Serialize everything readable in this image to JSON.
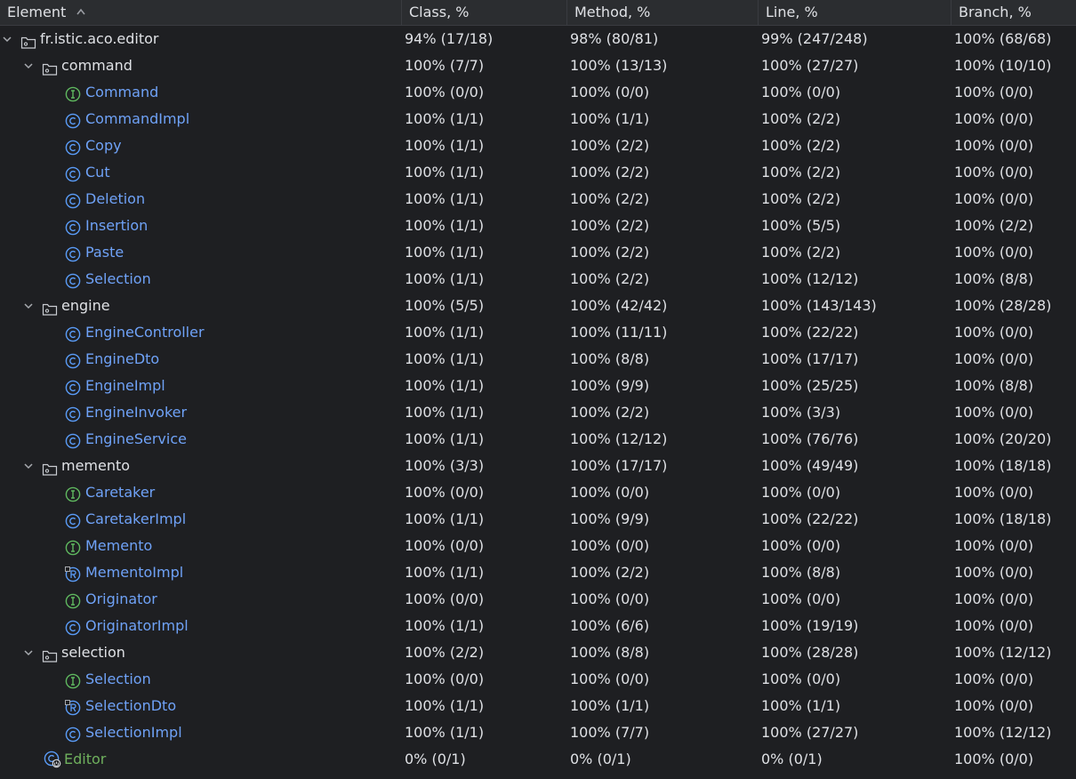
{
  "header": {
    "element": "Element",
    "class_pct": "Class, %",
    "method_pct": "Method, %",
    "line_pct": "Line, %",
    "branch_pct": "Branch, %"
  },
  "rows": [
    {
      "name": "fr.istic.aco.editor",
      "kind": "package",
      "level": 0,
      "expanded": true,
      "class": "94% (17/18)",
      "method": "98% (80/81)",
      "line": "99% (247/248)",
      "branch": "100% (68/68)"
    },
    {
      "name": "command",
      "kind": "package",
      "level": 1,
      "expanded": true,
      "class": "100% (7/7)",
      "method": "100% (13/13)",
      "line": "100% (27/27)",
      "branch": "100% (10/10)"
    },
    {
      "name": "Command",
      "kind": "interface",
      "level": 2,
      "class": "100% (0/0)",
      "method": "100% (0/0)",
      "line": "100% (0/0)",
      "branch": "100% (0/0)"
    },
    {
      "name": "CommandImpl",
      "kind": "class",
      "level": 2,
      "class": "100% (1/1)",
      "method": "100% (1/1)",
      "line": "100% (2/2)",
      "branch": "100% (0/0)"
    },
    {
      "name": "Copy",
      "kind": "class",
      "level": 2,
      "class": "100% (1/1)",
      "method": "100% (2/2)",
      "line": "100% (2/2)",
      "branch": "100% (0/0)"
    },
    {
      "name": "Cut",
      "kind": "class",
      "level": 2,
      "class": "100% (1/1)",
      "method": "100% (2/2)",
      "line": "100% (2/2)",
      "branch": "100% (0/0)"
    },
    {
      "name": "Deletion",
      "kind": "class",
      "level": 2,
      "class": "100% (1/1)",
      "method": "100% (2/2)",
      "line": "100% (2/2)",
      "branch": "100% (0/0)"
    },
    {
      "name": "Insertion",
      "kind": "class",
      "level": 2,
      "class": "100% (1/1)",
      "method": "100% (2/2)",
      "line": "100% (5/5)",
      "branch": "100% (2/2)"
    },
    {
      "name": "Paste",
      "kind": "class",
      "level": 2,
      "class": "100% (1/1)",
      "method": "100% (2/2)",
      "line": "100% (2/2)",
      "branch": "100% (0/0)"
    },
    {
      "name": "Selection",
      "kind": "class",
      "level": 2,
      "class": "100% (1/1)",
      "method": "100% (2/2)",
      "line": "100% (12/12)",
      "branch": "100% (8/8)"
    },
    {
      "name": "engine",
      "kind": "package",
      "level": 1,
      "expanded": true,
      "class": "100% (5/5)",
      "method": "100% (42/42)",
      "line": "100% (143/143)",
      "branch": "100% (28/28)"
    },
    {
      "name": "EngineController",
      "kind": "class",
      "level": 2,
      "class": "100% (1/1)",
      "method": "100% (11/11)",
      "line": "100% (22/22)",
      "branch": "100% (0/0)"
    },
    {
      "name": "EngineDto",
      "kind": "class",
      "level": 2,
      "class": "100% (1/1)",
      "method": "100% (8/8)",
      "line": "100% (17/17)",
      "branch": "100% (0/0)"
    },
    {
      "name": "EngineImpl",
      "kind": "class",
      "level": 2,
      "class": "100% (1/1)",
      "method": "100% (9/9)",
      "line": "100% (25/25)",
      "branch": "100% (8/8)"
    },
    {
      "name": "EngineInvoker",
      "kind": "class",
      "level": 2,
      "class": "100% (1/1)",
      "method": "100% (2/2)",
      "line": "100% (3/3)",
      "branch": "100% (0/0)"
    },
    {
      "name": "EngineService",
      "kind": "class",
      "level": 2,
      "class": "100% (1/1)",
      "method": "100% (12/12)",
      "line": "100% (76/76)",
      "branch": "100% (20/20)"
    },
    {
      "name": "memento",
      "kind": "package",
      "level": 1,
      "expanded": true,
      "class": "100% (3/3)",
      "method": "100% (17/17)",
      "line": "100% (49/49)",
      "branch": "100% (18/18)"
    },
    {
      "name": "Caretaker",
      "kind": "interface",
      "level": 2,
      "class": "100% (0/0)",
      "method": "100% (0/0)",
      "line": "100% (0/0)",
      "branch": "100% (0/0)"
    },
    {
      "name": "CaretakerImpl",
      "kind": "class",
      "level": 2,
      "class": "100% (1/1)",
      "method": "100% (9/9)",
      "line": "100% (22/22)",
      "branch": "100% (18/18)"
    },
    {
      "name": "Memento",
      "kind": "interface",
      "level": 2,
      "class": "100% (0/0)",
      "method": "100% (0/0)",
      "line": "100% (0/0)",
      "branch": "100% (0/0)"
    },
    {
      "name": "MementoImpl",
      "kind": "record",
      "level": 2,
      "class": "100% (1/1)",
      "method": "100% (2/2)",
      "line": "100% (8/8)",
      "branch": "100% (0/0)"
    },
    {
      "name": "Originator",
      "kind": "interface",
      "level": 2,
      "class": "100% (0/0)",
      "method": "100% (0/0)",
      "line": "100% (0/0)",
      "branch": "100% (0/0)"
    },
    {
      "name": "OriginatorImpl",
      "kind": "class",
      "level": 2,
      "class": "100% (1/1)",
      "method": "100% (6/6)",
      "line": "100% (19/19)",
      "branch": "100% (0/0)"
    },
    {
      "name": "selection",
      "kind": "package",
      "level": 1,
      "expanded": true,
      "class": "100% (2/2)",
      "method": "100% (8/8)",
      "line": "100% (28/28)",
      "branch": "100% (12/12)"
    },
    {
      "name": "Selection",
      "kind": "interface",
      "level": 2,
      "class": "100% (0/0)",
      "method": "100% (0/0)",
      "line": "100% (0/0)",
      "branch": "100% (0/0)"
    },
    {
      "name": "SelectionDto",
      "kind": "record",
      "level": 2,
      "class": "100% (1/1)",
      "method": "100% (1/1)",
      "line": "100% (1/1)",
      "branch": "100% (0/0)"
    },
    {
      "name": "SelectionImpl",
      "kind": "class",
      "level": 2,
      "class": "100% (1/1)",
      "method": "100% (7/7)",
      "line": "100% (27/27)",
      "branch": "100% (12/12)"
    },
    {
      "name": "Editor",
      "kind": "app-class",
      "level": 1,
      "class": "0% (0/1)",
      "method": "0% (0/1)",
      "line": "0% (0/1)",
      "branch": "100% (0/0)"
    }
  ],
  "colors": {
    "background": "#1e1f22",
    "header_background": "#2b2d30",
    "text": "#dfe1e5",
    "class_name": "#6fa2f7",
    "interface_icon": "#5fb85f",
    "class_icon": "#5a9cf8",
    "uncovered_class_name": "#6fb05d"
  },
  "icons": {
    "sort": "sort-ascending-icon",
    "expand": "chevron-down-icon",
    "package": "package-folder-icon",
    "class": "class-icon",
    "interface": "interface-icon",
    "record": "record-icon",
    "app-class": "spring-boot-class-icon"
  }
}
